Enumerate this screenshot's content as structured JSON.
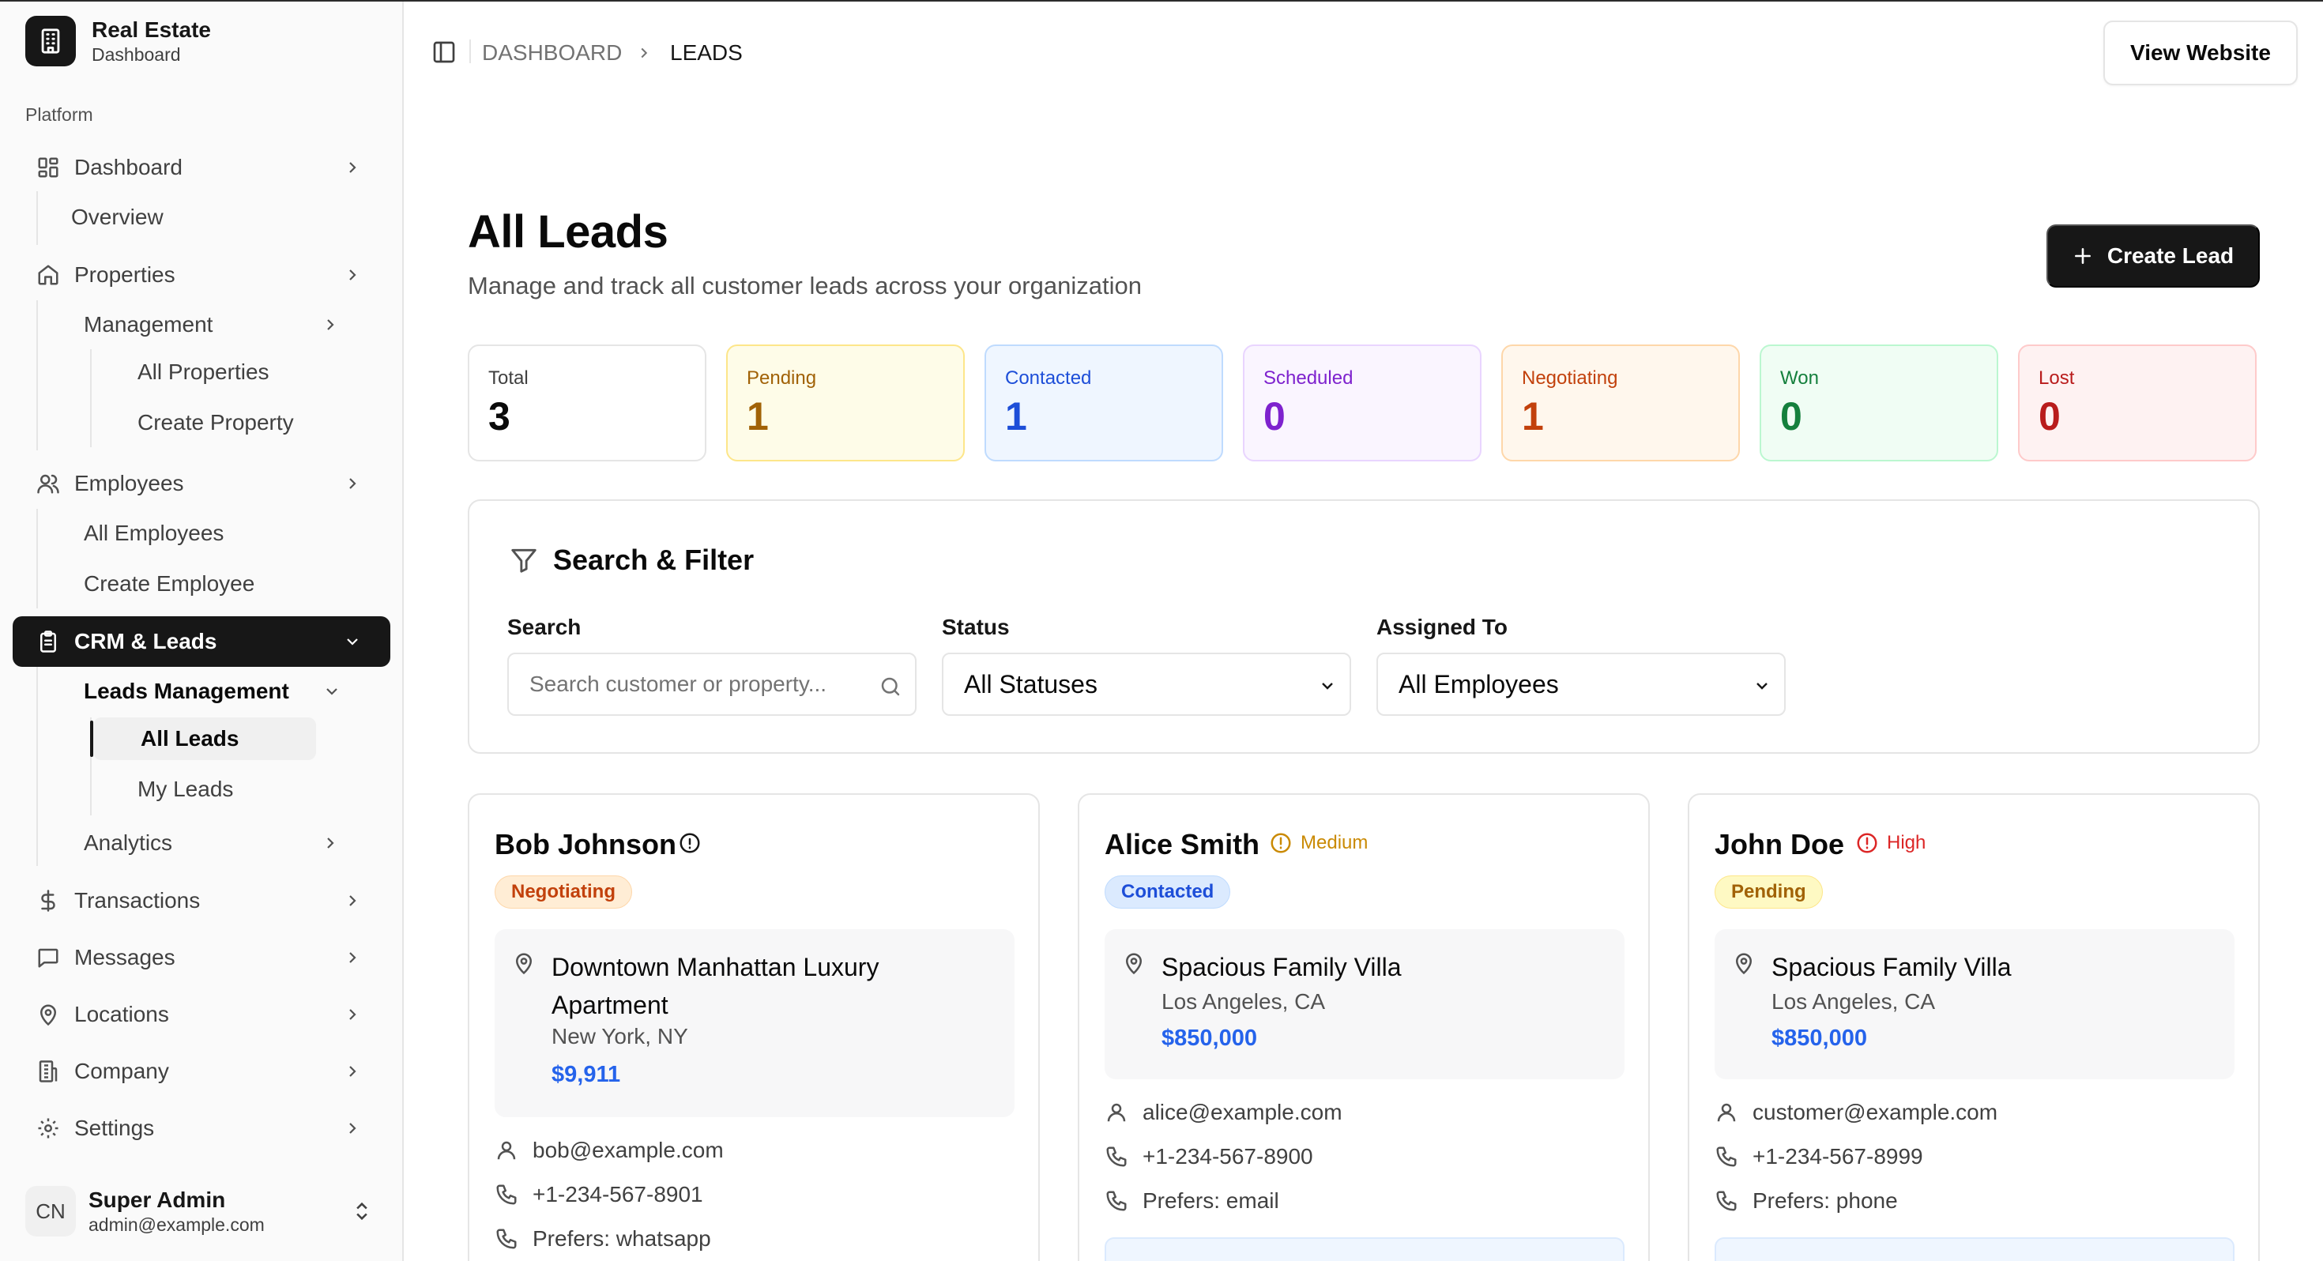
{
  "brand": {
    "title": "Real Estate",
    "subtitle": "Dashboard",
    "icon": "building-icon"
  },
  "sidebar": {
    "group_label": "Platform",
    "items": [
      {
        "label": "Dashboard",
        "icon": "dashboard-icon",
        "sub": [
          "Overview"
        ]
      },
      {
        "label": "Properties",
        "icon": "house-icon",
        "sub": [
          "Management"
        ],
        "management_sub": [
          "All Properties",
          "Create Property"
        ]
      },
      {
        "label": "Employees",
        "icon": "users-icon",
        "sub": [
          "All Employees",
          "Create Employee"
        ]
      },
      {
        "label": "CRM & Leads",
        "icon": "clipboard-icon",
        "sub": [
          "Leads Management",
          "Analytics"
        ],
        "leads_sub": [
          "All Leads",
          "My Leads"
        ]
      },
      {
        "label": "Transactions",
        "icon": "dollar-icon"
      },
      {
        "label": "Messages",
        "icon": "message-icon"
      },
      {
        "label": "Locations",
        "icon": "map-pin-icon"
      },
      {
        "label": "Company",
        "icon": "building-office-icon"
      },
      {
        "label": "Settings",
        "icon": "gear-icon"
      }
    ],
    "user": {
      "initials": "CN",
      "name": "Super Admin",
      "email": "admin@example.com"
    }
  },
  "header": {
    "breadcrumb": [
      "DASHBOARD",
      "LEADS"
    ],
    "view_website": "View Website"
  },
  "page": {
    "title": "All Leads",
    "subtitle": "Manage and track all customer leads across your organization",
    "create_button": "Create Lead"
  },
  "stats": [
    {
      "label": "Total",
      "value": "3",
      "bg": "#ffffff",
      "border": "#e5e5e5",
      "label_color": "#404040",
      "value_color": "#0a0a0a"
    },
    {
      "label": "Pending",
      "value": "1",
      "bg": "#fefce8",
      "border": "#fde68a",
      "label_color": "#a16207",
      "value_color": "#a16207"
    },
    {
      "label": "Contacted",
      "value": "1",
      "bg": "#eff6ff",
      "border": "#bfdbfe",
      "label_color": "#1d4ed8",
      "value_color": "#1d4ed8"
    },
    {
      "label": "Scheduled",
      "value": "0",
      "bg": "#faf5ff",
      "border": "#e9d5ff",
      "label_color": "#7e22ce",
      "value_color": "#7e22ce"
    },
    {
      "label": "Negotiating",
      "value": "1",
      "bg": "#fff7ed",
      "border": "#fed7aa",
      "label_color": "#c2410c",
      "value_color": "#c2410c"
    },
    {
      "label": "Won",
      "value": "0",
      "bg": "#f0fdf4",
      "border": "#bbf7d0",
      "label_color": "#15803d",
      "value_color": "#15803d"
    },
    {
      "label": "Lost",
      "value": "0",
      "bg": "#fef2f2",
      "border": "#fecaca",
      "label_color": "#b91c1c",
      "value_color": "#b91c1c"
    }
  ],
  "filter": {
    "title": "Search & Filter",
    "search_label": "Search",
    "search_placeholder": "Search customer or property...",
    "status_label": "Status",
    "status_value": "All Statuses",
    "assigned_label": "Assigned To",
    "assigned_value": "All Employees"
  },
  "leads": [
    {
      "name": "Bob Johnson",
      "priority": "",
      "status": "Negotiating",
      "property": "Downtown Manhattan Luxury Apartment",
      "location": "New York, NY",
      "price": "$9,911",
      "email": "bob@example.com",
      "phone": "+1-234-567-8901",
      "prefers": "Prefers: whatsapp"
    },
    {
      "name": "Alice Smith",
      "priority": "Medium",
      "status": "Contacted",
      "property": "Spacious Family Villa",
      "location": "Los Angeles, CA",
      "price": "$850,000",
      "email": "alice@example.com",
      "phone": "+1-234-567-8900",
      "prefers": "Prefers: email"
    },
    {
      "name": "John Doe",
      "priority": "High",
      "status": "Pending",
      "property": "Spacious Family Villa",
      "location": "Los Angeles, CA",
      "price": "$850,000",
      "email": "customer@example.com",
      "phone": "+1-234-567-8999",
      "prefers": "Prefers: phone"
    }
  ],
  "colors": {
    "accent_dark": "#171717",
    "price_blue": "#2563eb",
    "priority_medium": "#ca8a04",
    "priority_high": "#dc2626"
  }
}
